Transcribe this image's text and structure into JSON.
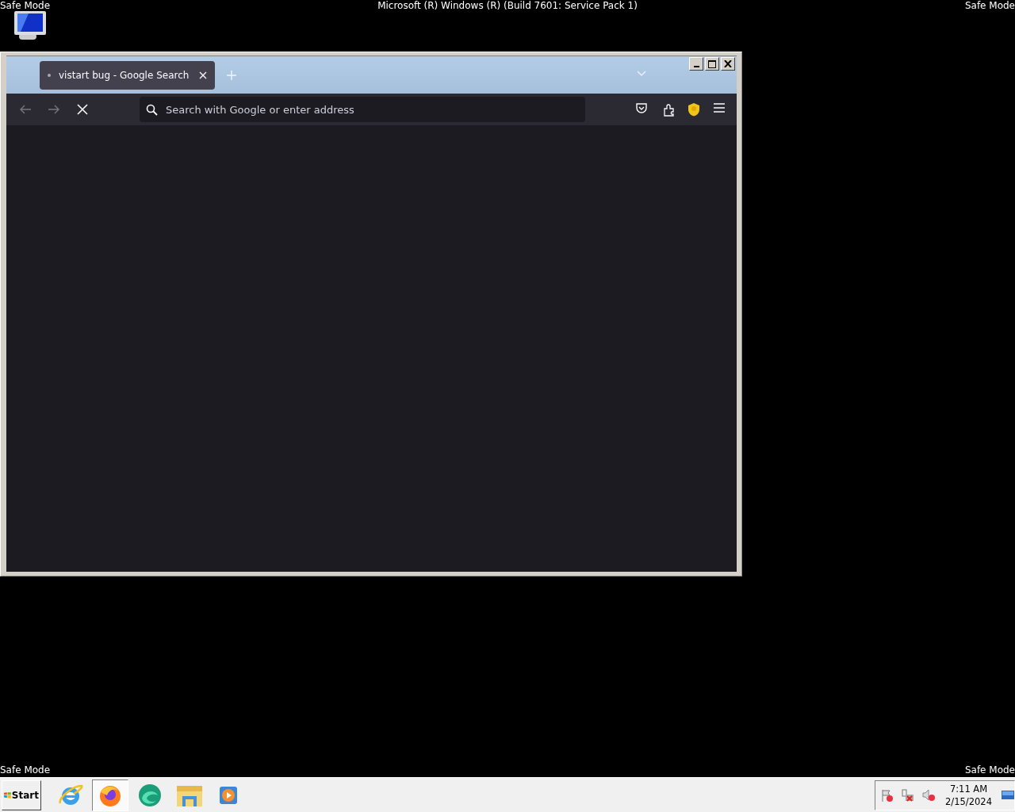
{
  "desktop": {
    "corner_labels": [
      "Safe Mode",
      "Safe Mode",
      "Safe Mode",
      "Safe Mode"
    ],
    "build_text": "Microsoft (R) Windows (R) (Build 7601: Service Pack 1)"
  },
  "browser": {
    "tabs": [
      {
        "title": "vistart bug - Google Search",
        "selected": true
      }
    ],
    "loading": true,
    "address_bar": {
      "placeholder": "Search with Google or enter address"
    }
  },
  "taskbar": {
    "start_label": "Start",
    "apps": [
      {
        "kind": "ie",
        "selected": false
      },
      {
        "kind": "firefox",
        "selected": true
      },
      {
        "kind": "edge",
        "selected": false
      },
      {
        "kind": "explorer",
        "selected": false
      },
      {
        "kind": "media",
        "selected": false
      }
    ],
    "clock": {
      "time": "7:11 AM",
      "date": "2/15/2024"
    }
  }
}
